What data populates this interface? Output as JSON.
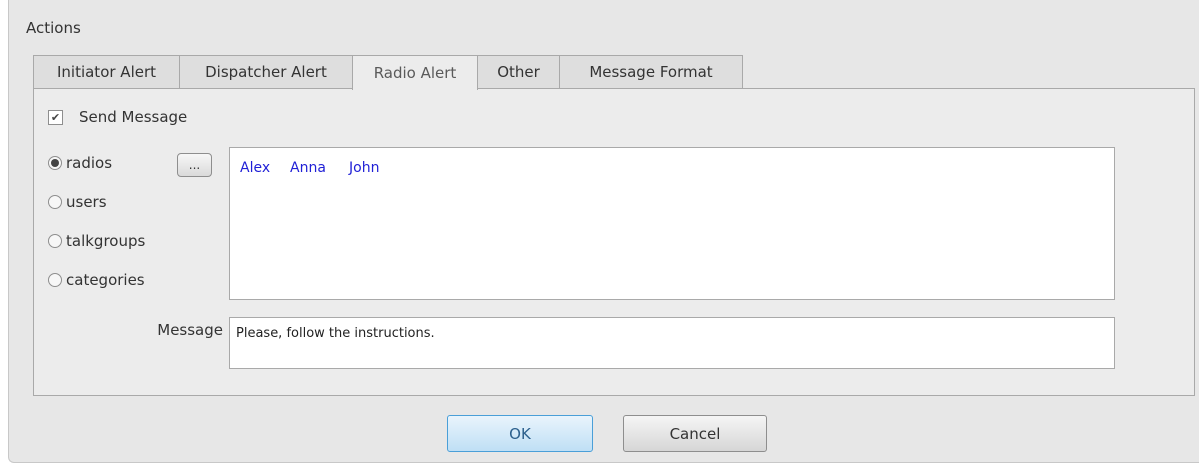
{
  "section_title": "Actions",
  "tabs": [
    {
      "label": "Initiator Alert",
      "active": false
    },
    {
      "label": "Dispatcher Alert",
      "active": false
    },
    {
      "label": "Radio Alert",
      "active": true
    },
    {
      "label": "Other",
      "active": false
    },
    {
      "label": "Message Format",
      "active": false
    }
  ],
  "send_message": {
    "label": "Send Message",
    "checked": true,
    "check_glyph": "✔"
  },
  "target_options": [
    {
      "label": "radios",
      "selected": true
    },
    {
      "label": "users",
      "selected": false
    },
    {
      "label": "talkgroups",
      "selected": false
    },
    {
      "label": "categories",
      "selected": false
    }
  ],
  "browse_button": {
    "label": "..."
  },
  "recipients": [
    "Alex",
    "Anna",
    "John"
  ],
  "message": {
    "label": "Message",
    "value": "Please, follow the instructions."
  },
  "buttons": {
    "ok": "OK",
    "cancel": "Cancel"
  },
  "colors": {
    "recipient_link": "#1f1fd6",
    "ok_border": "#4a9fd8",
    "dialog_bg": "#e7e7e7"
  }
}
